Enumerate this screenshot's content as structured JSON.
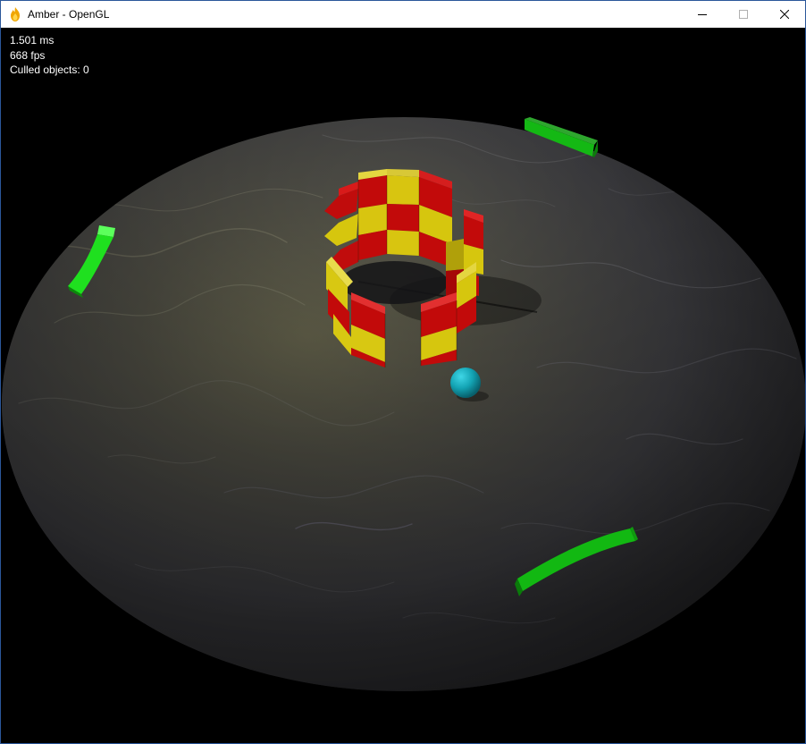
{
  "window": {
    "title": "Amber - OpenGL",
    "app_icon": "flame-icon",
    "controls": {
      "minimize_icon": "minimize-icon",
      "maximize_icon": "maximize-icon",
      "close_icon": "close-icon"
    }
  },
  "hud": {
    "frame_time": "1.501 ms",
    "fps": "668 fps",
    "culled": "Culled objects: 0"
  },
  "scene": {
    "objects": [
      "marble-disc-floor",
      "checkered-cylinder-tower",
      "cyan-ball",
      "green-paddle-left",
      "green-paddle-top-right",
      "green-paddle-bottom-right"
    ],
    "colors": {
      "background": "#000000",
      "floor": "#4a4a48",
      "tower_red": "#c20a0a",
      "tower_yellow": "#d6c70e",
      "ball": "#11a8b8",
      "paddle_bright": "#1fe51f",
      "paddle_dark": "#10a810"
    }
  }
}
